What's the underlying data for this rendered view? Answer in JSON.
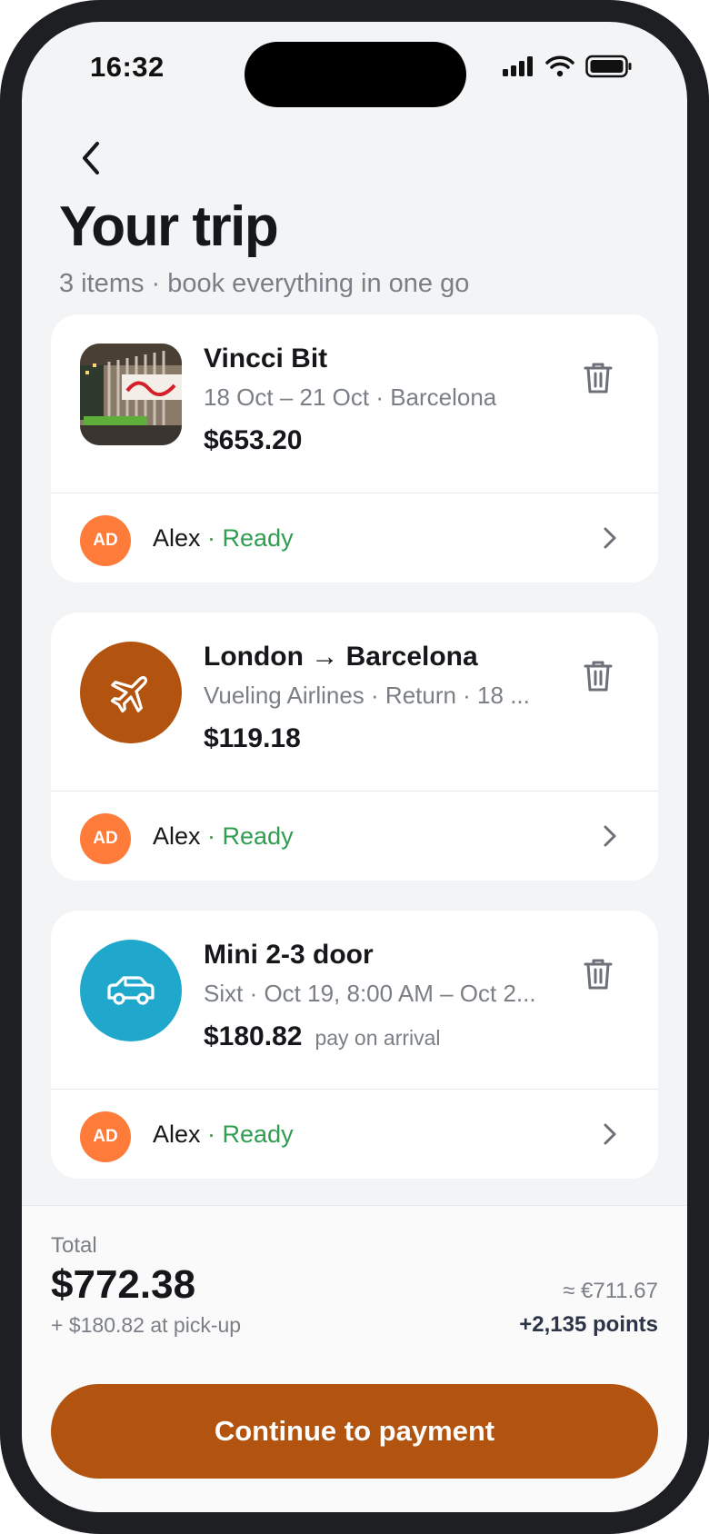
{
  "status_bar": {
    "time": "16:32"
  },
  "header": {
    "back_icon": "chevron-left-icon",
    "title": "Your trip",
    "subtitle": "3 items · book everything in one go"
  },
  "items": [
    {
      "type": "hotel",
      "title": "Vincci Bit",
      "detail": "18 Oct – 21 Oct · Barcelona",
      "price": "$653.20",
      "note": "",
      "traveler": {
        "initials": "AD",
        "name": "Alex",
        "status": "· Ready"
      }
    },
    {
      "type": "flight",
      "icon": "airplane-icon",
      "icon_color": "#b2530f",
      "title": "London → Barcelona",
      "detail": "Vueling Airlines · Return · 18 ...",
      "price": "$119.18",
      "note": "",
      "traveler": {
        "initials": "AD",
        "name": "Alex",
        "status": "· Ready"
      }
    },
    {
      "type": "car",
      "icon": "car-icon",
      "icon_color": "#1fa7cc",
      "title": "Mini 2-3 door",
      "detail": "Sixt · Oct 19, 8:00 AM – Oct 2...",
      "price": "$180.82",
      "note": "pay on arrival",
      "traveler": {
        "initials": "AD",
        "name": "Alex",
        "status": "· Ready"
      }
    }
  ],
  "footer": {
    "total_label": "Total",
    "total_amount": "$772.38",
    "pickup_note": "+ $180.82 at pick-up",
    "converted": "≈ €711.67",
    "points": "+2,135 points",
    "cta_label": "Continue to payment"
  },
  "colors": {
    "accent": "#b2530f",
    "avatar": "#ff7b3a",
    "ready": "#2e9e4f",
    "car": "#1fa7cc"
  }
}
